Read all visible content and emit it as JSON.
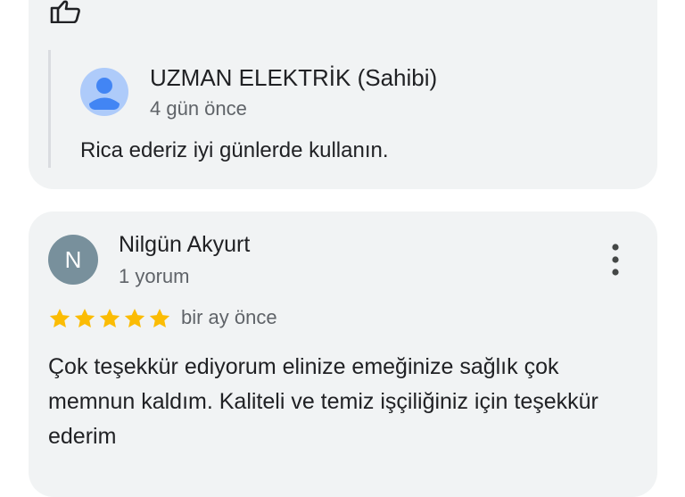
{
  "owner_reply": {
    "name": "UZMAN ELEKTRİK (Sahibi)",
    "time": "4 gün önce",
    "text": "Rica ederiz iyi günlerde kullanın."
  },
  "review": {
    "avatar_letter": "N",
    "name": "Nilgün Akyurt",
    "meta": "1 yorum",
    "rating": 5,
    "time": "bir ay önce",
    "text": "Çok teşekkür ediyorum elinize emeğinize sağlık çok memnun kaldım. Kaliteli ve temiz işçiliğiniz için teşekkür ederim"
  },
  "icons": {
    "like": "thumbs-up-icon",
    "more": "more-vert-icon",
    "star": "star-icon",
    "owner_avatar": "person-icon"
  },
  "colors": {
    "card_bg": "#f1f3f4",
    "star": "#fbbc04",
    "avatar_bg": "#78909c",
    "owner_avatar_bg": "#aecbfa",
    "owner_avatar_fg": "#4285f4"
  }
}
